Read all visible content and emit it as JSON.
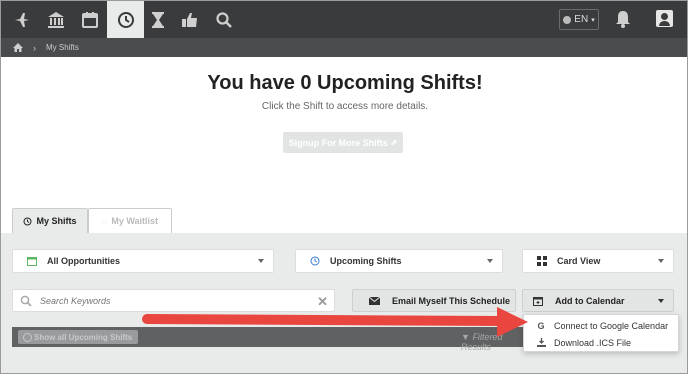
{
  "nav": {
    "icons": [
      "plane-icon",
      "bank-icon",
      "calendar-icon",
      "clock-icon",
      "hourglass-icon",
      "thumbs-up-icon",
      "search-icon"
    ],
    "language": "EN"
  },
  "breadcrumb": {
    "current": "My Shifts"
  },
  "main": {
    "title": "You have 0 Upcoming Shifts!",
    "subtitle": "Click the Shift to access more details.",
    "signup_label": "Signup For More Shifts"
  },
  "tabs": [
    {
      "label": "My Shifts",
      "active": true
    },
    {
      "label": "My Waitlist",
      "active": false
    }
  ],
  "filters": {
    "opportunities": "All Opportunities",
    "shifts": "Upcoming Shifts",
    "view": "Card View",
    "search_placeholder": "Search Keywords",
    "email_label": "Email Myself This Schedule",
    "calendar_label": "Add to Calendar"
  },
  "results": {
    "show_all": "Show all Upcoming Shifts",
    "filtered": "Filtered Results"
  },
  "calendar_menu": [
    {
      "icon": "google-icon",
      "label": "Connect to Google Calendar"
    },
    {
      "icon": "download-icon",
      "label": "Download .ICS File"
    }
  ],
  "colors": {
    "nav_bg": "#3a3b3c",
    "arrow": "#e8463f",
    "calendar_green": "#5cb85c",
    "clock_blue": "#3a7bd5"
  }
}
